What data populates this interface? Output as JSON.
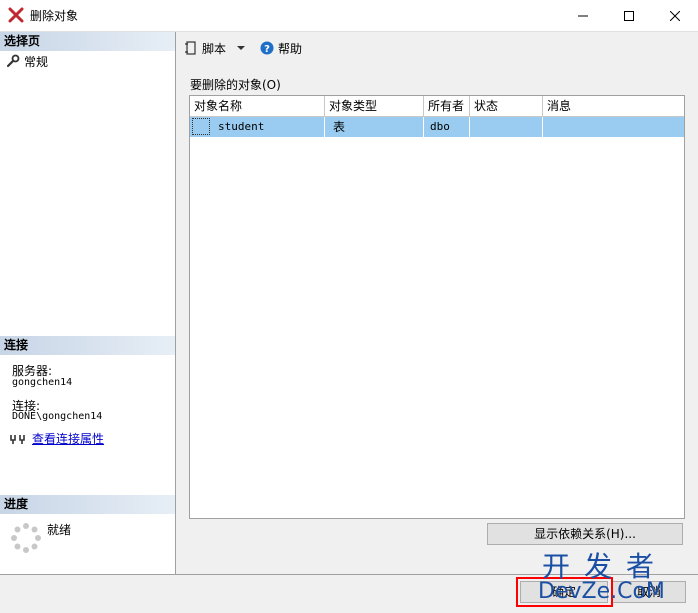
{
  "window": {
    "title": "删除对象",
    "icon": "red-x-icon"
  },
  "left": {
    "select_page_header": "选择页",
    "pages": [
      {
        "label": "常规",
        "icon": "wrench-icon"
      }
    ],
    "connection_header": "连接",
    "server_label": "服务器:",
    "server_value": "gongchen14",
    "connection_label": "连接:",
    "connection_value": "DONE\\gongchen14",
    "view_connection_link": "查看连接属性",
    "progress_header": "进度",
    "progress_status": "就绪"
  },
  "toolbar": {
    "script_label": "脚本",
    "help_label": "帮助"
  },
  "main": {
    "objects_label": "要删除的对象(O)",
    "columns": [
      "对象名称",
      "对象类型",
      "所有者",
      "状态",
      "消息"
    ],
    "rows": [
      {
        "name": "student",
        "type": "表",
        "owner": "dbo",
        "status": "",
        "message": ""
      }
    ],
    "dependencies_button": "显示依赖关系(H)..."
  },
  "buttons": {
    "ok_label": "确定",
    "cancel_label": "取消"
  },
  "watermark": {
    "line1": "开发者",
    "line2": "DevZe.CoM"
  }
}
